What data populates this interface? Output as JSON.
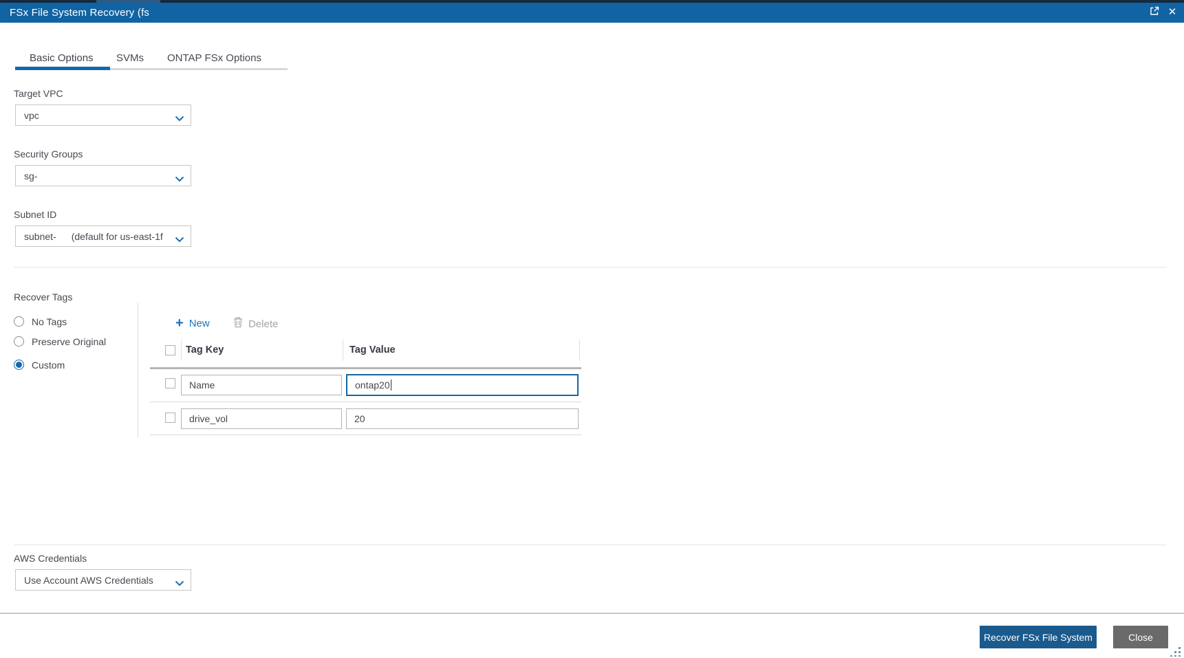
{
  "window": {
    "title": "FSx File System Recovery (fs",
    "close_glyph": "✕"
  },
  "tabs": [
    {
      "label": "Basic Options",
      "active": true
    },
    {
      "label": "SVMs",
      "active": false
    },
    {
      "label": "ONTAP FSx Options",
      "active": false
    }
  ],
  "form": {
    "target_vpc": {
      "label": "Target VPC",
      "value": "vpc"
    },
    "security_groups": {
      "label": "Security Groups",
      "value": "sg-"
    },
    "subnet_id": {
      "label": "Subnet ID",
      "value": "subnet-",
      "value_suffix": "(default for us-east-1f"
    },
    "aws_credentials": {
      "label": "AWS Credentials",
      "value": "Use Account AWS Credentials"
    }
  },
  "recover_tags": {
    "label": "Recover Tags",
    "options": [
      {
        "label": "No Tags",
        "selected": false
      },
      {
        "label": "Preserve Original",
        "selected": false
      },
      {
        "label": "Custom",
        "selected": true
      }
    ],
    "toolbar": {
      "new_label": "New",
      "delete_label": "Delete"
    },
    "table": {
      "columns": {
        "key": "Tag Key",
        "value": "Tag Value"
      },
      "rows": [
        {
          "key": "Name",
          "value": "ontap20",
          "checked": false,
          "value_focused": true
        },
        {
          "key": "drive_vol",
          "value": "20",
          "checked": false,
          "value_focused": false
        }
      ]
    }
  },
  "footer": {
    "recover_label": "Recover FSx File System",
    "close_label": "Close"
  },
  "colors": {
    "titlebar": "#1164a3",
    "accent_blue": "#1368ad",
    "link_blue": "#1a74c0",
    "recover_button": "#1a5a8c",
    "close_button": "#6a6a6a",
    "focused_input_border": "#1565a3"
  }
}
